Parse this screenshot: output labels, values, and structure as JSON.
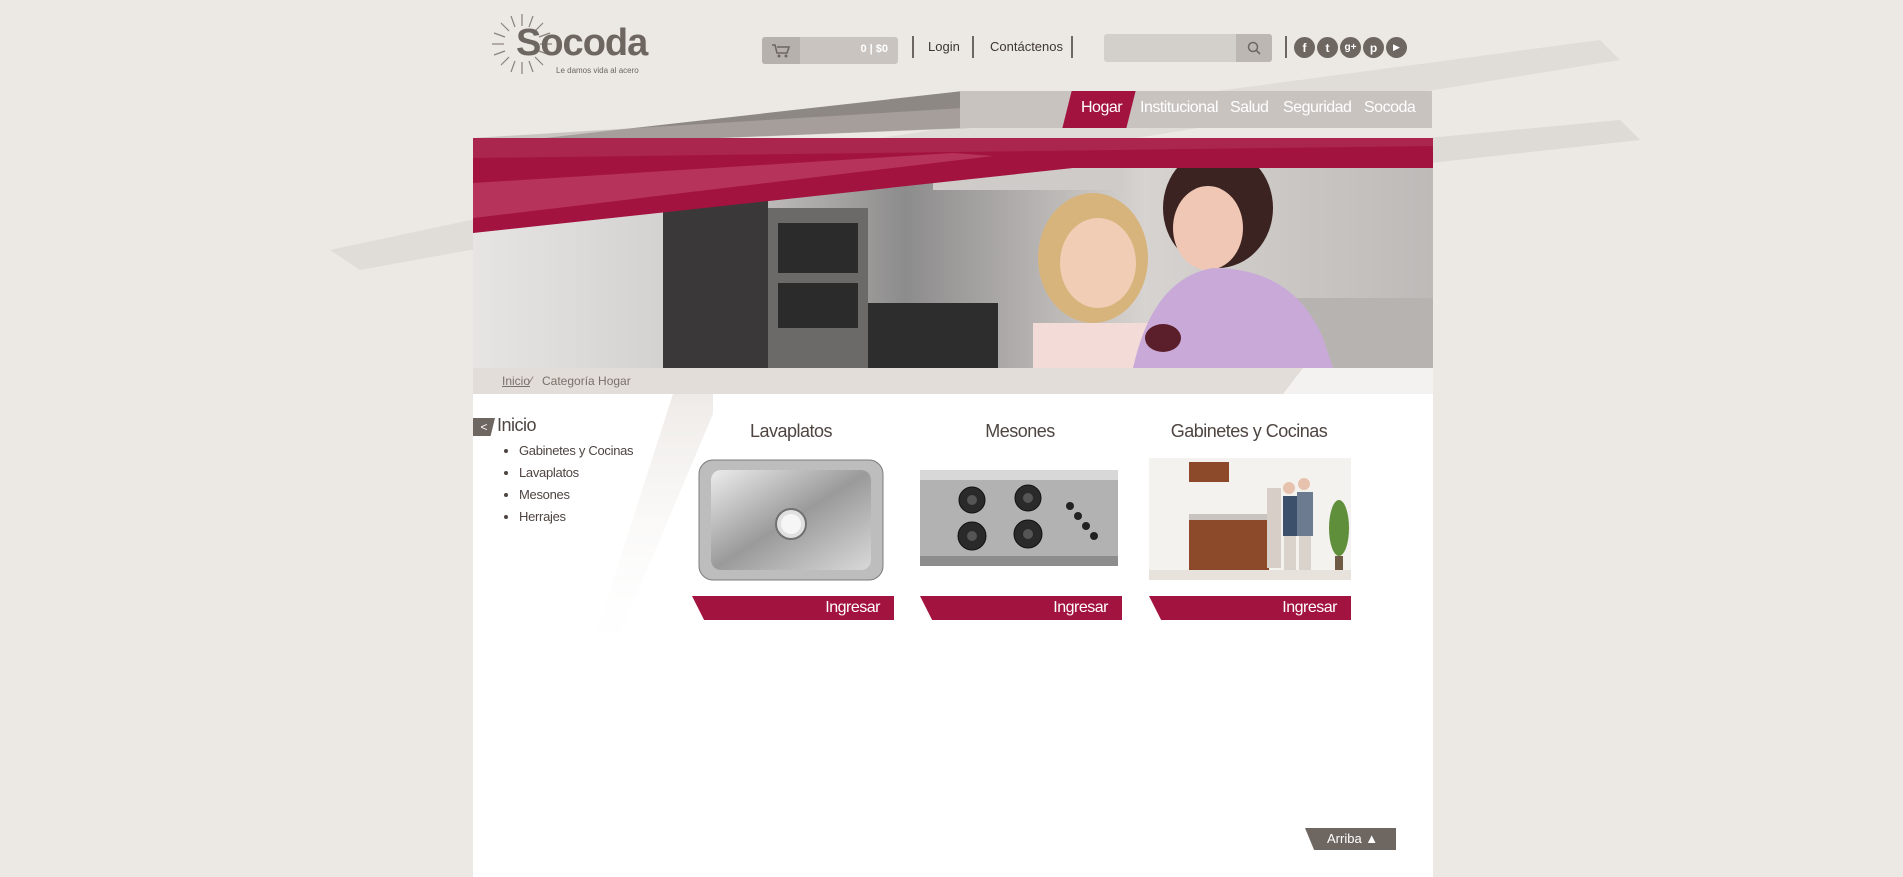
{
  "brand": {
    "name": "Socoda",
    "tagline": "Le damos vida al acero",
    "accent": "#a3133f",
    "gray": "#6e6661"
  },
  "header": {
    "cart_summary": "0 | $0",
    "login": "Login",
    "contact": "Contáctenos",
    "search_placeholder": "",
    "social": [
      {
        "icon": "facebook-icon",
        "glyph": "f"
      },
      {
        "icon": "twitter-icon",
        "glyph": "t"
      },
      {
        "icon": "google-plus-icon",
        "glyph": "g+"
      },
      {
        "icon": "pinterest-icon",
        "glyph": "p"
      },
      {
        "icon": "youtube-icon",
        "glyph": "▶"
      }
    ]
  },
  "nav": {
    "items": [
      {
        "label": "Hogar",
        "active": true
      },
      {
        "label": "Institucional",
        "active": false
      },
      {
        "label": "Salud",
        "active": false
      },
      {
        "label": "Seguridad",
        "active": false
      },
      {
        "label": "Socoda",
        "active": false
      }
    ]
  },
  "breadcrumb": {
    "home": "Inicio",
    "separator": "⁄",
    "current": "Categoría Hogar"
  },
  "sidebar": {
    "title": "Inicio",
    "back_glyph": "<",
    "items": [
      {
        "label": "Gabinetes y Cocinas"
      },
      {
        "label": "Lavaplatos"
      },
      {
        "label": "Mesones"
      },
      {
        "label": "Herrajes"
      }
    ]
  },
  "products": [
    {
      "title": "Lavaplatos",
      "button": "Ingresar",
      "image": "kitchen-sink"
    },
    {
      "title": "Mesones",
      "button": "Ingresar",
      "image": "gas-cooktop"
    },
    {
      "title": "Gabinetes y Cocinas",
      "button": "Ingresar",
      "image": "family-kitchen"
    }
  ],
  "footer": {
    "back_to_top": "Arriba ▲"
  }
}
